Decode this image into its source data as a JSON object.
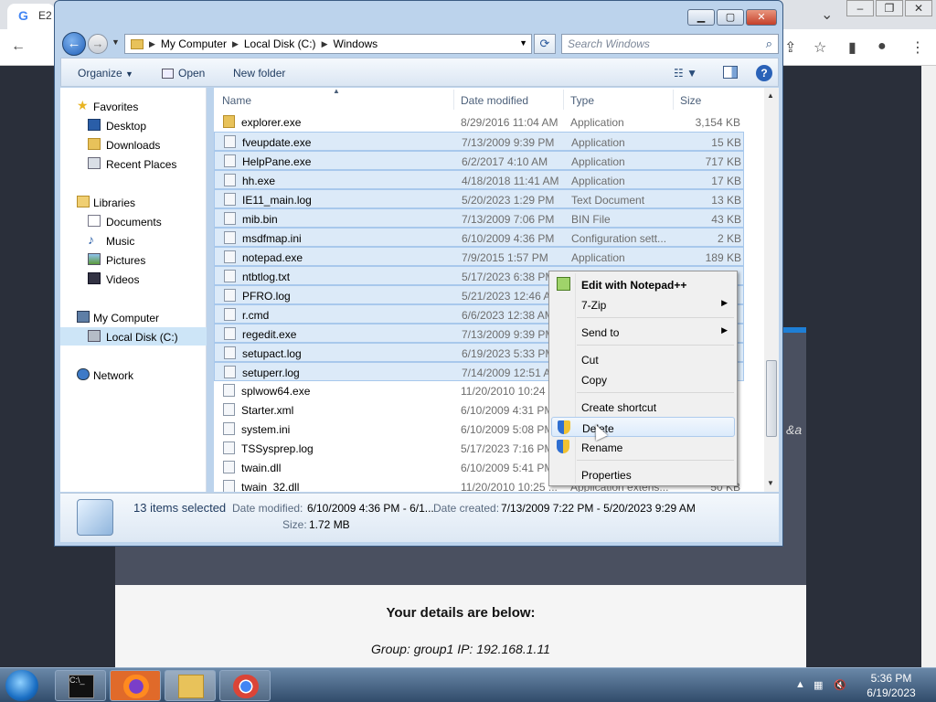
{
  "browser": {
    "tab_title": "E2",
    "tab_icon": "G",
    "details_heading": "Your details are below:",
    "group_line": "Group: group1   IP: 192.168.1.11",
    "fragment": "&a"
  },
  "window": {
    "minimize": "▁",
    "maximize": "▢",
    "close": "✕"
  },
  "address": {
    "segments": [
      "My Computer",
      "Local Disk (C:)",
      "Windows"
    ],
    "search_placeholder": "Search Windows"
  },
  "toolbar": {
    "organize": "Organize",
    "open": "Open",
    "new_folder": "New folder"
  },
  "nav": {
    "favorites": "Favorites",
    "desktop": "Desktop",
    "downloads": "Downloads",
    "recent": "Recent Places",
    "libraries": "Libraries",
    "documents": "Documents",
    "music": "Music",
    "pictures": "Pictures",
    "videos": "Videos",
    "computer": "My Computer",
    "local_disk": "Local Disk (C:)",
    "network": "Network"
  },
  "columns": {
    "name": "Name",
    "date": "Date modified",
    "type": "Type",
    "size": "Size"
  },
  "files": [
    {
      "name": "explorer.exe",
      "date": "8/29/2016 11:04 AM",
      "type": "Application",
      "size": "3,154 KB",
      "selected": false
    },
    {
      "name": "fveupdate.exe",
      "date": "7/13/2009 9:39 PM",
      "type": "Application",
      "size": "15 KB",
      "selected": true
    },
    {
      "name": "HelpPane.exe",
      "date": "6/2/2017 4:10 AM",
      "type": "Application",
      "size": "717 KB",
      "selected": true
    },
    {
      "name": "hh.exe",
      "date": "4/18/2018 11:41 AM",
      "type": "Application",
      "size": "17 KB",
      "selected": true
    },
    {
      "name": "IE11_main.log",
      "date": "5/20/2023 1:29 PM",
      "type": "Text Document",
      "size": "13 KB",
      "selected": true
    },
    {
      "name": "mib.bin",
      "date": "7/13/2009 7:06 PM",
      "type": "BIN File",
      "size": "43 KB",
      "selected": true
    },
    {
      "name": "msdfmap.ini",
      "date": "6/10/2009 4:36 PM",
      "type": "Configuration sett...",
      "size": "2 KB",
      "selected": true
    },
    {
      "name": "notepad.exe",
      "date": "7/9/2015 1:57 PM",
      "type": "Application",
      "size": "189 KB",
      "selected": true
    },
    {
      "name": "ntbtlog.txt",
      "date": "5/17/2023 6:38 PM",
      "type": "",
      "size": "",
      "selected": true
    },
    {
      "name": "PFRO.log",
      "date": "5/21/2023 12:46 AM",
      "type": "",
      "size": "",
      "selected": true
    },
    {
      "name": "r.cmd",
      "date": "6/6/2023 12:38 AM",
      "type": "",
      "size": "",
      "selected": true
    },
    {
      "name": "regedit.exe",
      "date": "7/13/2009 9:39 PM",
      "type": "",
      "size": "",
      "selected": true
    },
    {
      "name": "setupact.log",
      "date": "6/19/2023 5:33 PM",
      "type": "",
      "size": "",
      "selected": true
    },
    {
      "name": "setuperr.log",
      "date": "7/14/2009 12:51 AM",
      "type": "",
      "size": "",
      "selected": true
    },
    {
      "name": "splwow64.exe",
      "date": "11/20/2010 10:24 ...",
      "type": "",
      "size": "",
      "selected": false
    },
    {
      "name": "Starter.xml",
      "date": "6/10/2009 4:31 PM",
      "type": "",
      "size": "",
      "selected": false
    },
    {
      "name": "system.ini",
      "date": "6/10/2009 5:08 PM",
      "type": "",
      "size": "",
      "selected": false
    },
    {
      "name": "TSSysprep.log",
      "date": "5/17/2023 7:16 PM",
      "type": "",
      "size": "",
      "selected": false
    },
    {
      "name": "twain.dll",
      "date": "6/10/2009 5:41 PM",
      "type": "",
      "size": "",
      "selected": false
    },
    {
      "name": "twain_32.dll",
      "date": "11/20/2010 10:25 ...",
      "type": "Application extens...",
      "size": "50 KB",
      "selected": false
    }
  ],
  "details": {
    "count": "13 items selected",
    "modified_label": "Date modified:",
    "modified_value": "6/10/2009 4:36 PM - 6/1...",
    "created_label": "Date created:",
    "created_value": "7/13/2009 7:22 PM - 5/20/2023 9:29 AM",
    "size_label": "Size:",
    "size_value": "1.72 MB"
  },
  "context_menu": {
    "edit_npp": "Edit with Notepad++",
    "zip": "7-Zip",
    "send_to": "Send to",
    "cut": "Cut",
    "copy": "Copy",
    "create_shortcut": "Create shortcut",
    "delete": "Delete",
    "rename": "Rename",
    "properties": "Properties"
  },
  "tray": {
    "time": "5:36 PM",
    "date": "6/19/2023"
  }
}
